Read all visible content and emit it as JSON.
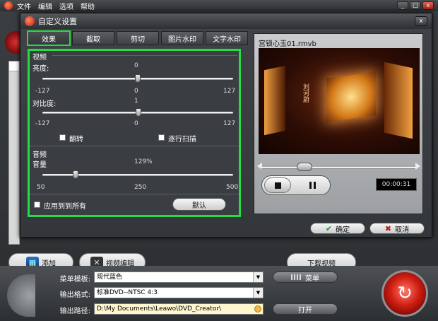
{
  "app": {
    "menu": [
      "文件",
      "编辑",
      "选项",
      "帮助"
    ],
    "win_min": "_",
    "win_max": "□",
    "win_close": "x"
  },
  "dialog": {
    "title": "自定义设置",
    "close": "x",
    "tabs": [
      "效果",
      "截取",
      "剪切",
      "图片水印",
      "文字水印"
    ],
    "active_tab": 0,
    "video_section": "视频",
    "brightness_label": "亮度:",
    "brightness": {
      "value": 0,
      "min": -127,
      "max": 127,
      "value_text": "0",
      "min_text": "-127",
      "mid_text": "0",
      "max_text": "127"
    },
    "contrast_label": "对比度:",
    "contrast": {
      "value": 1,
      "min": -127,
      "max": 127,
      "value_text": "1",
      "min_text": "-127",
      "mid_text": "0",
      "max_text": "127"
    },
    "flip_label": "翻转",
    "progressive_label": "逐行扫描",
    "audio_section": "音频",
    "volume_label": "音量",
    "volume": {
      "value": 129,
      "min": 50,
      "max": 500,
      "value_text": "129%",
      "min_text": "50",
      "mid_text": "250",
      "max_text": "500"
    },
    "apply_all_label": "应用到到所有",
    "default_label": "默认",
    "preview": {
      "filename": "宫锁心玉01.rmvb",
      "video_caption": "刘河蔚",
      "timecode": "00:00:31",
      "progress": 0.2
    },
    "ok_label": "确定",
    "cancel_label": "取消"
  },
  "toolbar": {
    "add_label": "添加",
    "video_edit_label": "视频编辑",
    "download_label": "下载视频"
  },
  "bottom": {
    "menu_template_label": "菜单模板:",
    "menu_template_value": "现代蓝色",
    "menu_button_label": "菜单",
    "output_format_label": "输出格式:",
    "output_format_value": "标准DVD--NTSC 4:3",
    "output_path_label": "输出路径:",
    "output_path_value": "D:\\My Documents\\Leawo\\DVD_Creator\\",
    "open_button_label": "打开"
  },
  "colors": {
    "highlight": "#22dd44",
    "brand_red": "#d01f12"
  }
}
